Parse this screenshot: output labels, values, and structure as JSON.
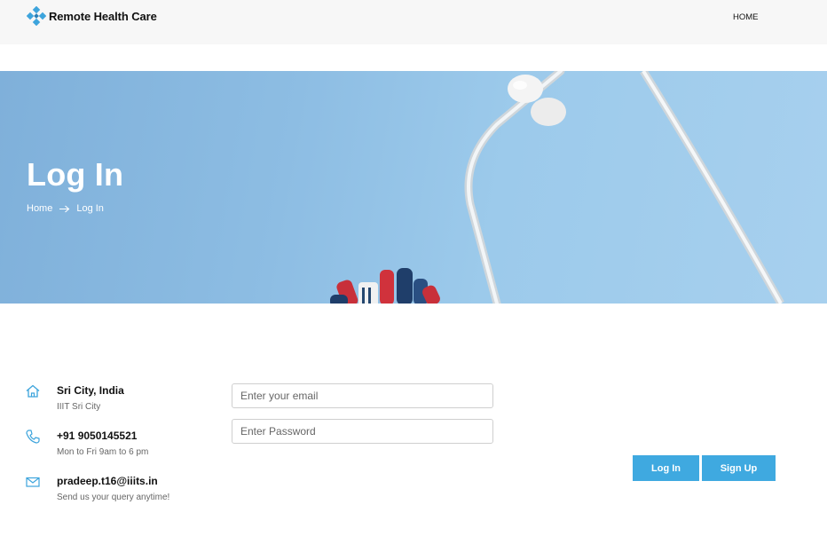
{
  "header": {
    "brand": "Remote Health Care",
    "nav": {
      "home": "HOME"
    }
  },
  "banner": {
    "title": "Log In",
    "breadcrumb": {
      "home": "Home",
      "current": "Log In"
    }
  },
  "contact": [
    {
      "icon": "home-icon",
      "title": "Sri City, India",
      "subtitle": "IIIT Sri City"
    },
    {
      "icon": "phone-icon",
      "title": "+91 9050145521",
      "subtitle": "Mon to Fri 9am to 6 pm"
    },
    {
      "icon": "mail-icon",
      "title": "pradeep.t16@iiits.in",
      "subtitle": "Send us your query anytime!"
    }
  ],
  "form": {
    "email": {
      "placeholder": "Enter your email",
      "value": ""
    },
    "password": {
      "placeholder": "Enter Password",
      "value": ""
    },
    "login_label": "Log In",
    "signup_label": "Sign Up"
  },
  "colors": {
    "accent": "#3fa9e0",
    "brand_icon": "#3da4dc",
    "banner_bg": "#8dbde3",
    "header_bg": "#f7f7f7"
  }
}
